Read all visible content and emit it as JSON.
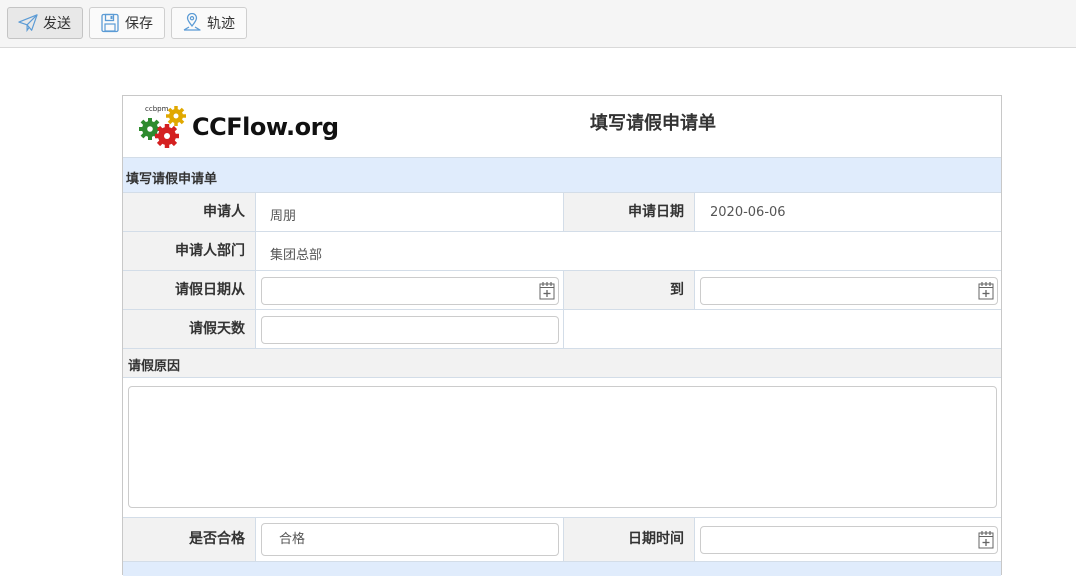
{
  "toolbar": {
    "buttons": [
      {
        "label": "发送",
        "icon": "send-icon"
      },
      {
        "label": "保存",
        "icon": "save-icon"
      },
      {
        "label": "轨迹",
        "icon": "track-icon"
      }
    ]
  },
  "form": {
    "logo": {
      "text": "CCFlow.org",
      "small_text": "ccbpm"
    },
    "title": "填写请假申请单",
    "section_title": "填写请假申请单",
    "fields": {
      "applicant": {
        "label": "申请人",
        "value": "周朋"
      },
      "apply_date": {
        "label": "申请日期",
        "value": "2020-06-06"
      },
      "department": {
        "label": "申请人部门",
        "value": "集团总部"
      },
      "leave_from": {
        "label": "请假日期从",
        "value": ""
      },
      "leave_to": {
        "label": "到",
        "value": ""
      },
      "leave_days": {
        "label": "请假天数",
        "value": ""
      },
      "reason": {
        "label": "请假原因",
        "value": ""
      },
      "qualified": {
        "label": "是否合格",
        "value": "合格"
      },
      "datetime": {
        "label": "日期时间",
        "value": ""
      }
    }
  },
  "colors": {
    "toolbar_bg": "#f5f5f5",
    "section_bg": "#e0ecfc",
    "label_bg": "#f2f2f2",
    "icon_blue": "#5b9bd5"
  }
}
